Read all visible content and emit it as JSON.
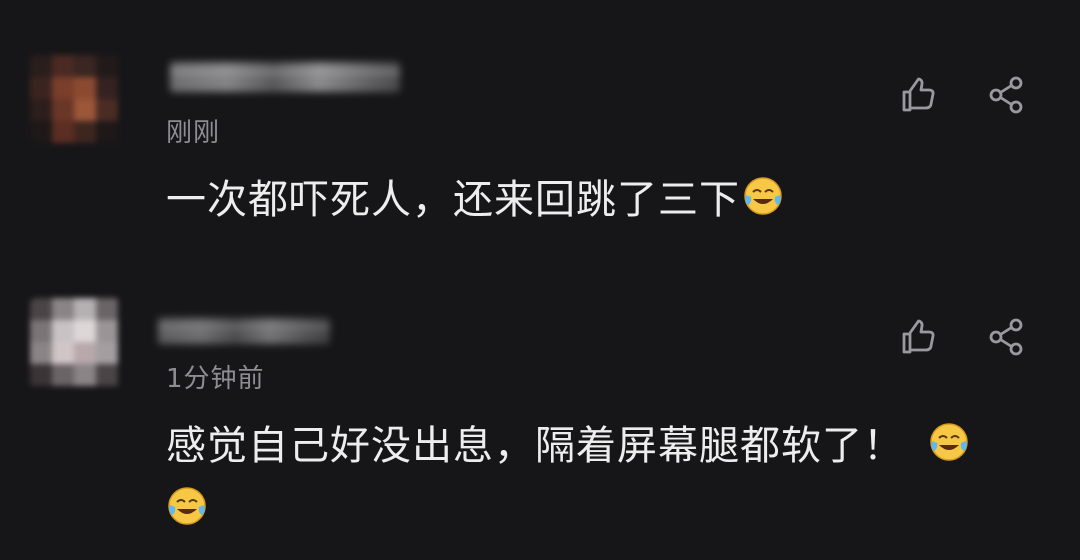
{
  "comments": [
    {
      "time": "刚刚",
      "text": "一次都吓死人，还来回跳了三下",
      "emojis": [
        "laughing-crying-emoji"
      ],
      "actions": [
        "thumbs-up-icon",
        "share-icon"
      ]
    },
    {
      "time": "1分钟前",
      "text": "感觉自己好没出息，隔着屏幕腿都软了！",
      "emojis": [
        "laughing-crying-emoji",
        "laughing-crying-emoji"
      ],
      "actions": [
        "thumbs-up-icon",
        "share-icon"
      ]
    }
  ],
  "colors": {
    "background": "#161618",
    "text": "#ededed",
    "muted": "#8e8e92",
    "icon": "#9a9a9e",
    "emoji_face": "#f7c845"
  }
}
